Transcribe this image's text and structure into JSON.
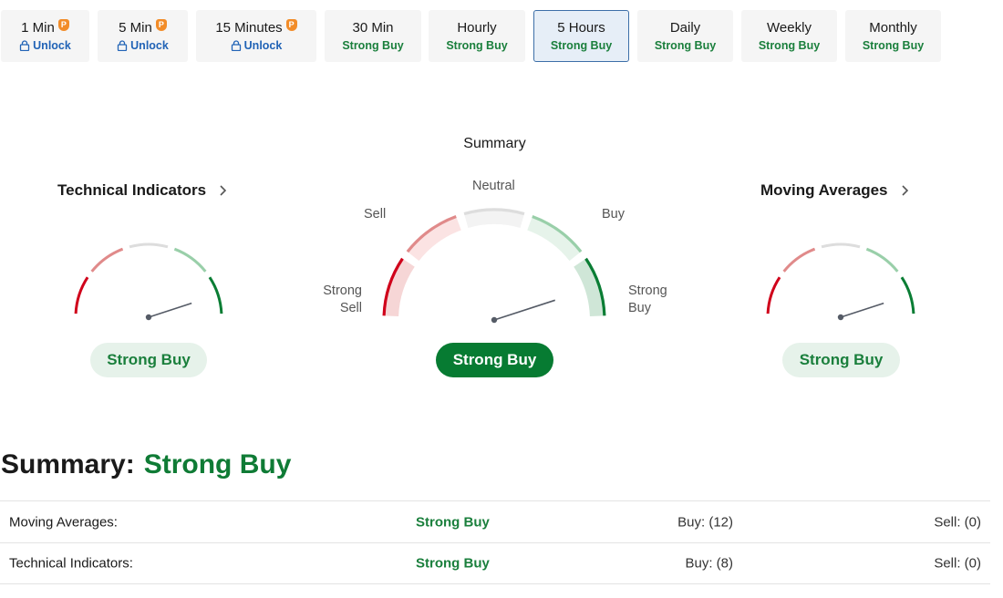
{
  "tabs": [
    {
      "title": "1 Min",
      "sub": "Unlock",
      "locked": true,
      "active": false
    },
    {
      "title": "5 Min",
      "sub": "Unlock",
      "locked": true,
      "active": false
    },
    {
      "title": "15 Minutes",
      "sub": "Unlock",
      "locked": true,
      "active": false
    },
    {
      "title": "30 Min",
      "sub": "Strong Buy",
      "locked": false,
      "active": false
    },
    {
      "title": "Hourly",
      "sub": "Strong Buy",
      "locked": false,
      "active": false
    },
    {
      "title": "5 Hours",
      "sub": "Strong Buy",
      "locked": false,
      "active": true
    },
    {
      "title": "Daily",
      "sub": "Strong Buy",
      "locked": false,
      "active": false
    },
    {
      "title": "Weekly",
      "sub": "Strong Buy",
      "locked": false,
      "active": false
    },
    {
      "title": "Monthly",
      "sub": "Strong Buy",
      "locked": false,
      "active": false
    }
  ],
  "pro_badge": "P",
  "summary": {
    "title": "Summary",
    "labels": {
      "sell": "Sell",
      "neutral": "Neutral",
      "buy": "Buy",
      "strong_sell": "Strong\nSell",
      "strong_buy": "Strong\nBuy"
    },
    "verdict": "Strong Buy",
    "needle_fraction": 0.9
  },
  "technical_indicators": {
    "title": "Technical Indicators",
    "verdict": "Strong Buy",
    "needle_fraction": 0.9
  },
  "moving_averages": {
    "title": "Moving Averages",
    "verdict": "Strong Buy",
    "needle_fraction": 0.9
  },
  "big_summary": {
    "label": "Summary:",
    "value": "Strong Buy"
  },
  "table": [
    {
      "name": "Moving Averages:",
      "verdict": "Strong Buy",
      "buy": "Buy: (12)",
      "sell": "Sell: (0)"
    },
    {
      "name": "Technical Indicators:",
      "verdict": "Strong Buy",
      "buy": "Buy: (8)",
      "sell": "Sell: (0)"
    }
  ],
  "colors": {
    "strong_sell": "#d0021b",
    "sell": "#e08a8a",
    "neutral": "#dddddd",
    "buy": "#99cfa9",
    "strong_buy": "#0a7d34",
    "needle": "#555b66",
    "accent_green": "#1a7f3c",
    "unlock_blue": "#2163b6"
  }
}
